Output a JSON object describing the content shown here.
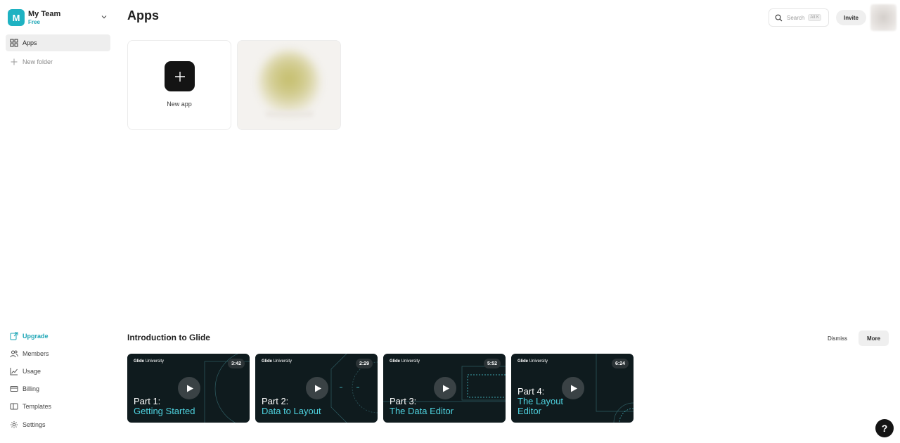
{
  "team": {
    "initial": "M",
    "name": "My Team",
    "plan": "Free"
  },
  "sidebar": {
    "nav": [
      {
        "label": "Apps",
        "icon": "grid-icon"
      },
      {
        "label": "New folder",
        "icon": "plus-icon"
      }
    ],
    "bottom": [
      {
        "label": "Upgrade",
        "icon": "upgrade-icon"
      },
      {
        "label": "Members",
        "icon": "members-icon"
      },
      {
        "label": "Usage",
        "icon": "usage-chart-icon"
      },
      {
        "label": "Billing",
        "icon": "billing-card-icon"
      },
      {
        "label": "Templates",
        "icon": "templates-icon"
      },
      {
        "label": "Settings",
        "icon": "gear-icon"
      }
    ]
  },
  "header": {
    "title": "Apps",
    "search_placeholder": "Search",
    "search_shortcut": "Alt K",
    "invite_label": "Invite"
  },
  "apps": {
    "new_app_label": "New app"
  },
  "intro": {
    "title": "Introduction to Glide",
    "dismiss_label": "Dismiss",
    "more_label": "More",
    "brand_bold": "Glide",
    "brand_rest": " University",
    "videos": [
      {
        "part": "Part 1:",
        "subtitle_line1": "Getting Started",
        "subtitle_line2": "",
        "duration": "3:42"
      },
      {
        "part": "Part 2:",
        "subtitle_line1": "Data to Layout",
        "subtitle_line2": "",
        "duration": "2:29"
      },
      {
        "part": "Part 3:",
        "subtitle_line1": "The Data Editor",
        "subtitle_line2": "",
        "duration": "5:52"
      },
      {
        "part": "Part 4:",
        "subtitle_line1": "The Layout",
        "subtitle_line2": "Editor",
        "duration": "6:24"
      }
    ]
  },
  "help_label": "?",
  "colors": {
    "accent": "#1ba5b5",
    "video_bg": "#0f1b1e",
    "video_subtitle": "#4fd3e0"
  }
}
